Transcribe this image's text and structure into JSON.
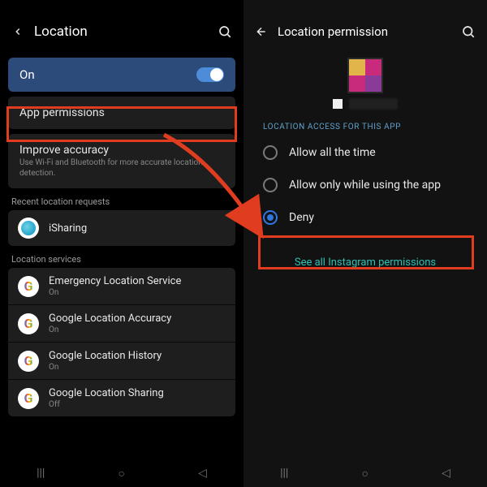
{
  "left": {
    "title": "Location",
    "toggle": {
      "label": "On",
      "state": true
    },
    "items": {
      "app_permissions": "App permissions",
      "improve": {
        "title": "Improve accuracy",
        "sub": "Use Wi-Fi and Bluetooth for more accurate location detection."
      }
    },
    "sections": {
      "recent": "Recent location requests",
      "services": "Location services"
    },
    "recent": [
      {
        "title": "iSharing",
        "icon": "isharing"
      }
    ],
    "services": [
      {
        "title": "Emergency Location Service",
        "sub": "On",
        "icon": "google"
      },
      {
        "title": "Google Location Accuracy",
        "sub": "On",
        "icon": "google"
      },
      {
        "title": "Google Location History",
        "sub": "On",
        "icon": "google"
      },
      {
        "title": "Google Location Sharing",
        "sub": "Off",
        "icon": "google"
      }
    ]
  },
  "right": {
    "title": "Location permission",
    "section_label": "LOCATION ACCESS FOR THIS APP",
    "options": [
      {
        "label": "Allow all the time",
        "selected": false
      },
      {
        "label": "Allow only while using the app",
        "selected": false
      },
      {
        "label": "Deny",
        "selected": true
      }
    ],
    "see_all": "See all Instagram permissions"
  },
  "annotation": {
    "highlight_color": "#e03c1f"
  }
}
